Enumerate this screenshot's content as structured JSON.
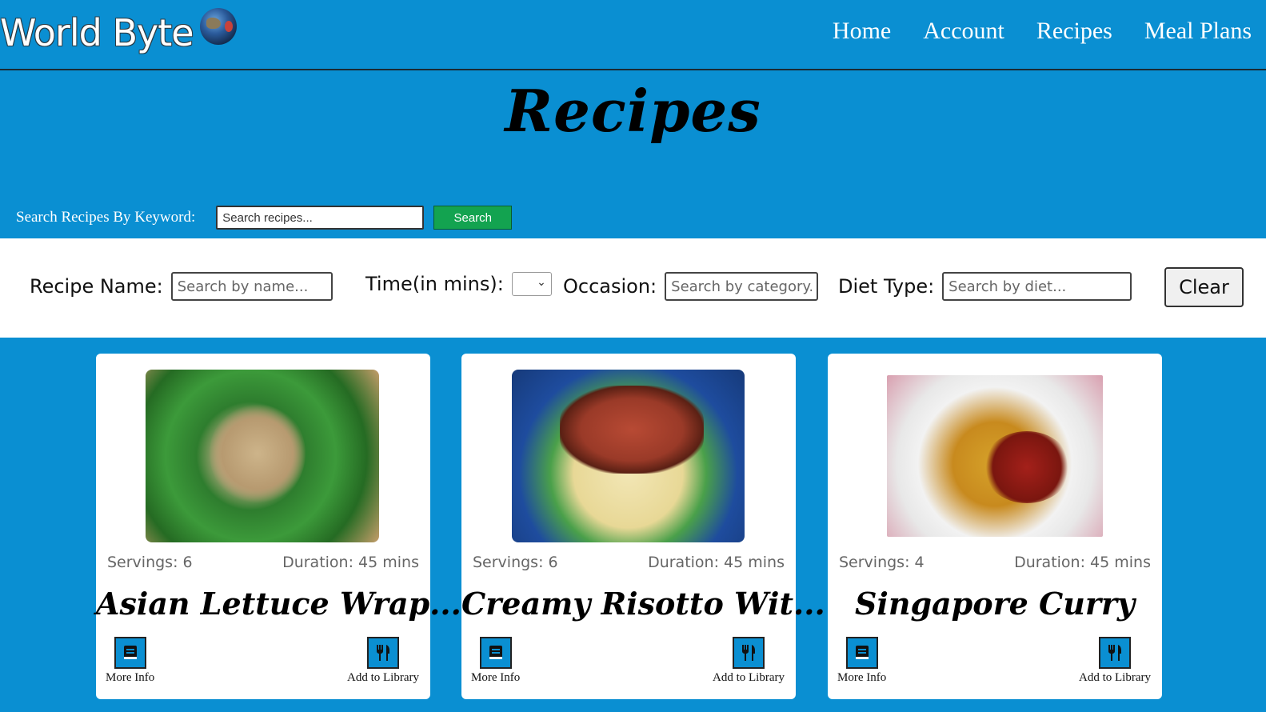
{
  "header": {
    "brand": "World Byte",
    "nav": [
      "Home",
      "Account",
      "Recipes",
      "Meal Plans"
    ]
  },
  "page_title": "Recipes",
  "keyword_search": {
    "label": "Search Recipes By Keyword:",
    "placeholder": "Search recipes...",
    "button": "Search"
  },
  "filters": {
    "recipe_name_label": "Recipe Name:",
    "recipe_name_placeholder": "Search by name...",
    "time_label": "Time(in mins):",
    "occasion_label": "Occasion:",
    "occasion_placeholder": "Search by category...",
    "diet_label": "Diet Type:",
    "diet_placeholder": "Search by diet...",
    "clear_button": "Clear"
  },
  "recipes": [
    {
      "servings": "Servings: 6",
      "duration": "Duration: 45 mins",
      "title": "Asian Lettuce Wrap...",
      "more_info": "More Info",
      "add_to_library": "Add to Library"
    },
    {
      "servings": "Servings: 6",
      "duration": "Duration: 45 mins",
      "title": "Creamy Risotto Wit...",
      "more_info": "More Info",
      "add_to_library": "Add to Library"
    },
    {
      "servings": "Servings: 4",
      "duration": "Duration: 45 mins",
      "title": "Singapore Curry",
      "more_info": "More Info",
      "add_to_library": "Add to Library"
    }
  ],
  "colors": {
    "background": "#0a8fd2",
    "search_button": "#13a350"
  },
  "icons": [
    "globe-icon",
    "book-icon",
    "utensils-icon",
    "chevron-down-icon"
  ]
}
